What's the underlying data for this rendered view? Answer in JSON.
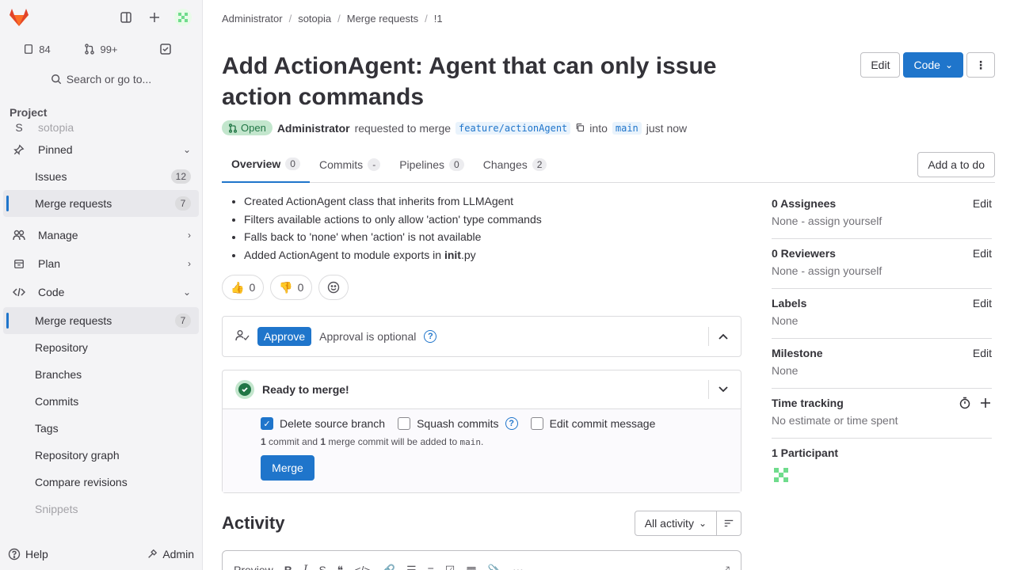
{
  "sidebar": {
    "counts": {
      "issues": "84",
      "merge_requests": "99+"
    },
    "search_label": "Search or go to...",
    "section_label": "Project",
    "project_initial": "S",
    "project_name": "sotopia",
    "items": [
      {
        "label": "Pinned"
      },
      {
        "label": "Issues",
        "badge": "12"
      },
      {
        "label": "Merge requests",
        "badge": "7"
      },
      {
        "label": "Manage"
      },
      {
        "label": "Plan"
      },
      {
        "label": "Code"
      },
      {
        "label": "Merge requests",
        "badge": "7"
      },
      {
        "label": "Repository"
      },
      {
        "label": "Branches"
      },
      {
        "label": "Commits"
      },
      {
        "label": "Tags"
      },
      {
        "label": "Repository graph"
      },
      {
        "label": "Compare revisions"
      },
      {
        "label": "Snippets"
      }
    ],
    "help_label": "Help",
    "admin_label": "Admin"
  },
  "breadcrumb": [
    "Administrator",
    "sotopia",
    "Merge requests",
    "!1"
  ],
  "mr": {
    "title": "Add ActionAgent: Agent that can only issue action commands",
    "edit_label": "Edit",
    "code_label": "Code",
    "status": "Open",
    "author": "Administrator",
    "requested_text": "requested to merge",
    "source_branch": "feature/actionAgent",
    "into_text": "into",
    "target_branch": "main",
    "time": "just now"
  },
  "tabs": [
    {
      "label": "Overview",
      "count": "0"
    },
    {
      "label": "Commits",
      "count": "-"
    },
    {
      "label": "Pipelines",
      "count": "0"
    },
    {
      "label": "Changes",
      "count": "2"
    }
  ],
  "todo_label": "Add a to do",
  "description": [
    "Created ActionAgent class that inherits from LLMAgent",
    "Filters available actions to only allow 'action' type commands",
    "Falls back to 'none' when 'action' is not available",
    "Added ActionAgent to module exports in ",
    "init",
    ".py"
  ],
  "reactions": {
    "thumbs_up": "0",
    "thumbs_down": "0"
  },
  "approval": {
    "button": "Approve",
    "text": "Approval is optional"
  },
  "merge": {
    "title": "Ready to merge!",
    "delete_branch": "Delete source branch",
    "squash": "Squash commits",
    "edit_message": "Edit commit message",
    "info_1": "1",
    "info_2": " commit and ",
    "info_3": "1",
    "info_4": " merge commit will be added to ",
    "info_branch": "main",
    "info_5": ".",
    "button": "Merge"
  },
  "activity": {
    "title": "Activity",
    "filter": "All activity"
  },
  "editor": {
    "preview": "Preview"
  },
  "side": {
    "assignees_title": "0 Assignees",
    "assignees_val": "None - assign yourself",
    "reviewers_title": "0 Reviewers",
    "reviewers_val": "None - assign yourself",
    "labels_title": "Labels",
    "labels_val": "None",
    "milestone_title": "Milestone",
    "milestone_val": "None",
    "time_title": "Time tracking",
    "time_val": "No estimate or time spent",
    "participants_title": "1 Participant",
    "edit": "Edit"
  }
}
